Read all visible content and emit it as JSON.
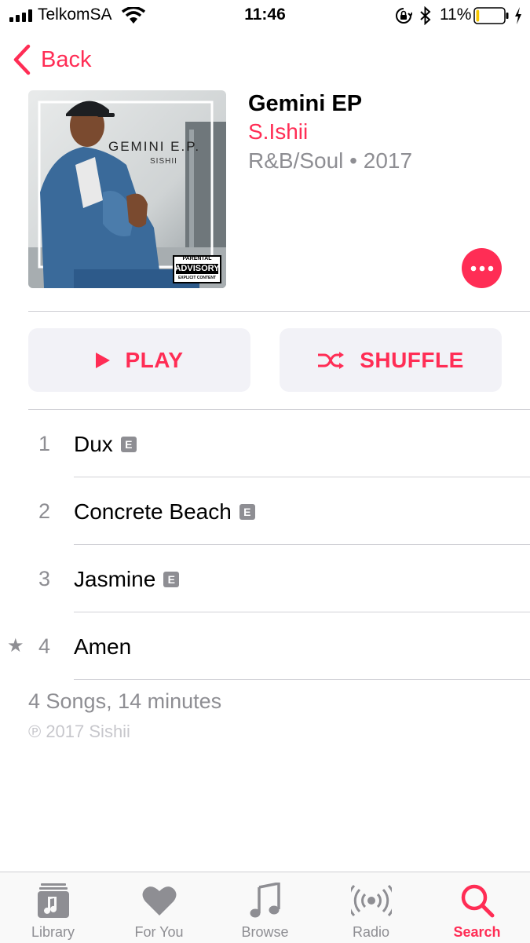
{
  "status_bar": {
    "carrier": "TelkomSA",
    "time": "11:46",
    "battery_percent": "11%",
    "battery_level": 0.11,
    "icons": [
      "signal-icon",
      "wifi-icon",
      "orientation-lock-icon",
      "bluetooth-icon",
      "battery-icon",
      "charging-icon"
    ]
  },
  "nav": {
    "back_label": "Back"
  },
  "album": {
    "title": "Gemini EP",
    "artist": "S.Ishii",
    "genre_year": "R&B/Soul • 2017",
    "cover_title": "GEMINI E.P.",
    "cover_artist": "SISHII",
    "advisory_top": "PARENTAL",
    "advisory_mid": "ADVISORY",
    "advisory_bottom": "EXPLICIT CONTENT"
  },
  "actions": {
    "play_label": "PLAY",
    "shuffle_label": "SHUFFLE"
  },
  "tracks": [
    {
      "number": "1",
      "title": "Dux",
      "explicit": "E"
    },
    {
      "number": "2",
      "title": "Concrete Beach",
      "explicit": "E"
    },
    {
      "number": "3",
      "title": "Jasmine",
      "explicit": "E"
    },
    {
      "number": "4",
      "title": "Amen",
      "star": "★"
    }
  ],
  "footer": {
    "summary": "4 Songs, 14 minutes",
    "copyright": "℗ 2017 Sishii"
  },
  "tabbar": {
    "tabs": [
      {
        "label": "Library",
        "icon": "library-icon"
      },
      {
        "label": "For You",
        "icon": "heart-icon"
      },
      {
        "label": "Browse",
        "icon": "music-note-icon"
      },
      {
        "label": "Radio",
        "icon": "radio-icon"
      },
      {
        "label": "Search",
        "icon": "search-icon",
        "active": true
      }
    ]
  },
  "colors": {
    "accent": "#ff2d55",
    "secondary_text": "#8e8e93",
    "button_bg": "#f2f2f7"
  }
}
